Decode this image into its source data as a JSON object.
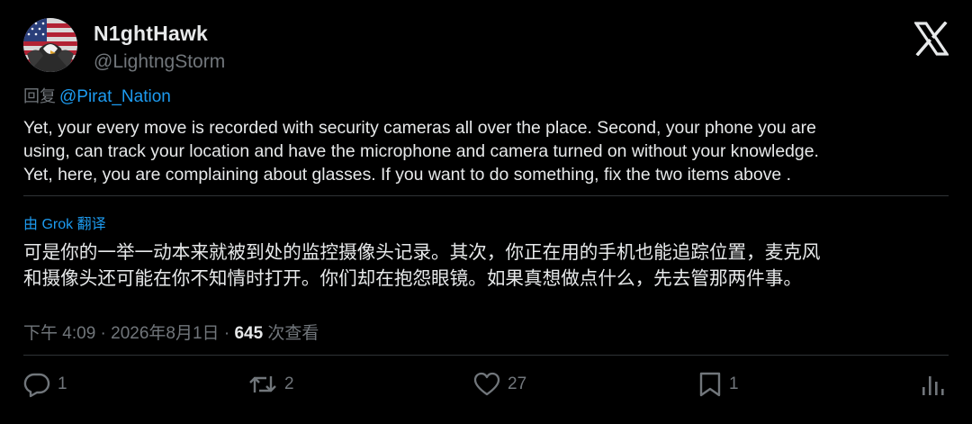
{
  "author": {
    "display_name": "N1ghtHawk",
    "handle": "@LightngStorm"
  },
  "reply": {
    "prefix": "回复",
    "to": "@Pirat_Nation"
  },
  "post": {
    "lines": [
      "Yet, your every move is recorded with security cameras all over the place. Second, your phone you are",
      "using, can track your location and have the microphone and camera turned on without your knowledge.",
      "Yet, here, you are complaining about glasses.  If you want to do something, fix the two  items above ."
    ]
  },
  "translation": {
    "label": "由 Grok 翻译",
    "lines": [
      "可是你的一举一动本来就被到处的监控摄像头记录。其次，你正在用的手机也能追踪位置，麦克风",
      "和摄像头还可能在你不知情时打开。你们却在抱怨眼镜。如果真想做点什么，先去管那两件事。"
    ]
  },
  "meta": {
    "time_date": "下午 4:09 · 2026年8月1日 · ",
    "views_count": "645",
    "views_label": " 次查看"
  },
  "actions": {
    "replies": "1",
    "reposts": "2",
    "likes": "27",
    "bookmarks": "1"
  },
  "icons": [
    "x-logo-icon",
    "reply-icon",
    "repost-icon",
    "like-icon",
    "bookmark-icon",
    "views-chart-icon"
  ],
  "colors": {
    "background": "#000000",
    "text": "#e7e9ea",
    "muted": "#71767b",
    "link": "#1d9bf0"
  }
}
